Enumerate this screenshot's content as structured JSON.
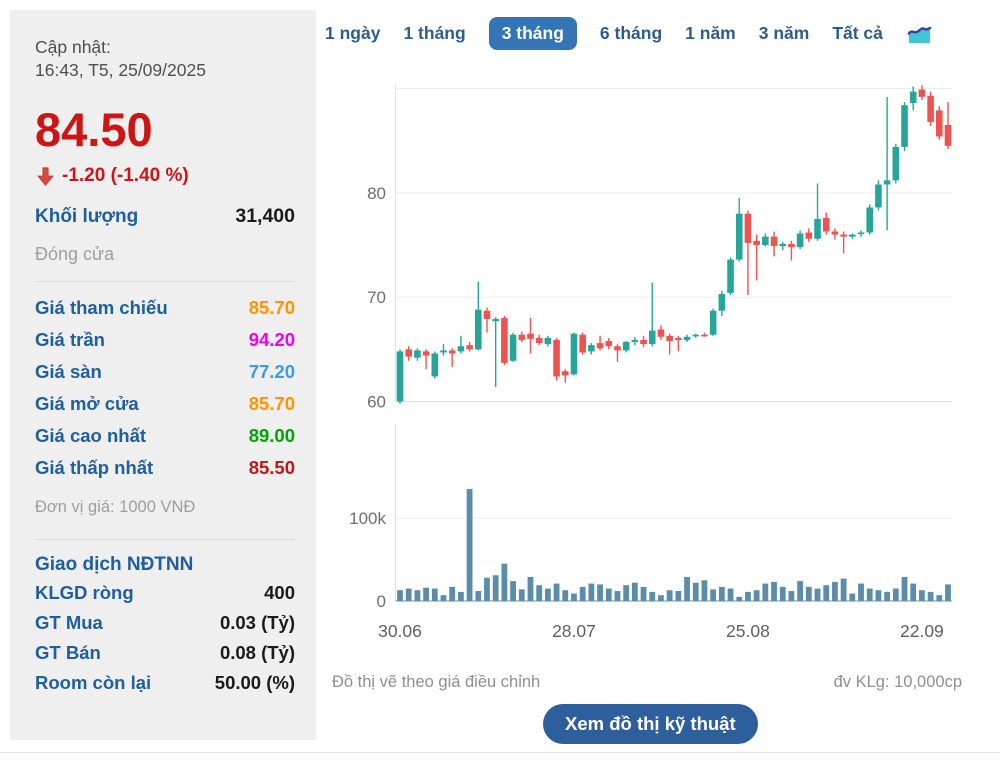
{
  "sidebar": {
    "updated_label": "Cập nhật:",
    "updated_time": "16:43, T5, 25/09/2025",
    "price": "84.50",
    "change": "-1.20 (-1.40 %)",
    "volume_label": "Khối lượng",
    "volume_value": "31,400",
    "session_status": "Đóng cửa",
    "price_rows": [
      {
        "label": "Giá tham chiếu",
        "value": "85.70",
        "color": "#ff9500"
      },
      {
        "label": "Giá trần",
        "value": "94.20",
        "color": "#f000f0"
      },
      {
        "label": "Giá sàn",
        "value": "77.20",
        "color": "#3e9be9"
      },
      {
        "label": "Giá mở cửa",
        "value": "85.70",
        "color": "#ff9500"
      },
      {
        "label": "Giá cao nhất",
        "value": "89.00",
        "color": "#00a400"
      },
      {
        "label": "Giá thấp nhất",
        "value": "85.50",
        "color": "#c01616"
      }
    ],
    "unit_note": "Đơn vị giá: 1000 VNĐ",
    "foreign_title": "Giao dịch NĐTNN",
    "foreign_rows": [
      {
        "label": "KLGD ròng",
        "value": "400"
      },
      {
        "label": "GT Mua",
        "value": "0.03 (Tỷ)"
      },
      {
        "label": "GT Bán",
        "value": "0.08 (Tỷ)"
      },
      {
        "label": "Room còn lại",
        "value": "50.00 (%)"
      }
    ]
  },
  "tabs": {
    "items": [
      {
        "label": "1 ngày",
        "active": false
      },
      {
        "label": "1 tháng",
        "active": false
      },
      {
        "label": "3 tháng",
        "active": true
      },
      {
        "label": "6 tháng",
        "active": false
      },
      {
        "label": "1 năm",
        "active": false
      },
      {
        "label": "3 năm",
        "active": false
      },
      {
        "label": "Tất cả",
        "active": false
      }
    ]
  },
  "footer": {
    "left_note": "Đồ thị vẽ theo giá điều chỉnh",
    "right_note": "đv KLg: 10,000cp",
    "button_label": "Xem đồ thị kỹ thuật"
  },
  "chart_data": {
    "type": "candlestick+volume",
    "title": "",
    "x_tick_indices": [
      0,
      20,
      40,
      60
    ],
    "x_tick_labels": [
      "30.06",
      "28.07",
      "25.08",
      "22.09"
    ],
    "price": {
      "ylim": [
        60,
        90
      ],
      "grid_values": [
        90,
        80,
        70
      ],
      "y_ticks": [
        {
          "value": 80,
          "label": "80"
        },
        {
          "value": 70,
          "label": "70"
        },
        {
          "value": 60,
          "label": "60"
        }
      ],
      "candles": [
        [
          60.0,
          65.0,
          59.8,
          64.8
        ],
        [
          65.0,
          65.3,
          63.9,
          64.3
        ],
        [
          64.2,
          65.1,
          63.9,
          64.9
        ],
        [
          64.8,
          65.0,
          63.1,
          64.4
        ],
        [
          62.4,
          64.8,
          62.2,
          64.6
        ],
        [
          64.7,
          65.5,
          64.4,
          64.9
        ],
        [
          64.9,
          65.1,
          63.3,
          64.6
        ],
        [
          64.8,
          66.3,
          64.6,
          65.3
        ],
        [
          65.4,
          65.7,
          64.8,
          65.0
        ],
        [
          65.0,
          71.5,
          64.9,
          68.8
        ],
        [
          68.7,
          69.0,
          66.6,
          67.9
        ],
        [
          67.7,
          68.1,
          61.4,
          67.9
        ],
        [
          68.0,
          68.2,
          63.5,
          63.7
        ],
        [
          63.9,
          66.6,
          63.8,
          66.4
        ],
        [
          66.4,
          66.7,
          65.7,
          65.9
        ],
        [
          66.5,
          68.0,
          64.6,
          66.0
        ],
        [
          66.1,
          66.4,
          65.4,
          65.6
        ],
        [
          65.5,
          66.3,
          65.3,
          66.1
        ],
        [
          65.9,
          66.1,
          62.0,
          62.4
        ],
        [
          62.9,
          63.1,
          61.8,
          62.5
        ],
        [
          62.6,
          66.6,
          62.5,
          66.5
        ],
        [
          66.4,
          66.6,
          64.5,
          64.7
        ],
        [
          64.8,
          65.6,
          64.5,
          65.4
        ],
        [
          65.6,
          66.3,
          64.9,
          65.1
        ],
        [
          65.8,
          66.1,
          65.0,
          65.3
        ],
        [
          65.3,
          65.5,
          63.8,
          64.9
        ],
        [
          64.9,
          65.8,
          64.7,
          65.7
        ],
        [
          65.7,
          66.2,
          65.4,
          65.9
        ],
        [
          65.9,
          66.3,
          65.2,
          65.5
        ],
        [
          65.5,
          71.4,
          65.3,
          66.8
        ],
        [
          66.9,
          67.3,
          65.9,
          66.2
        ],
        [
          66.3,
          66.5,
          64.5,
          65.8
        ],
        [
          66.1,
          66.3,
          64.8,
          65.9
        ],
        [
          65.9,
          66.4,
          65.7,
          66.2
        ],
        [
          66.3,
          66.5,
          66.1,
          66.4
        ],
        [
          66.4,
          66.6,
          66.2,
          66.3
        ],
        [
          66.4,
          68.9,
          66.3,
          68.7
        ],
        [
          68.7,
          70.6,
          68.2,
          70.3
        ],
        [
          70.4,
          73.8,
          70.2,
          73.6
        ],
        [
          73.6,
          79.5,
          73.4,
          78.0
        ],
        [
          78.0,
          78.3,
          70.2,
          75.2
        ],
        [
          75.4,
          76.0,
          71.6,
          75.0
        ],
        [
          75.0,
          76.1,
          74.9,
          75.8
        ],
        [
          75.8,
          76.3,
          73.9,
          74.9
        ],
        [
          74.9,
          75.3,
          74.5,
          75.1
        ],
        [
          75.1,
          75.4,
          73.5,
          74.8
        ],
        [
          74.8,
          76.4,
          74.6,
          76.1
        ],
        [
          76.2,
          76.6,
          75.3,
          75.6
        ],
        [
          75.6,
          80.9,
          75.4,
          77.5
        ],
        [
          77.6,
          78.1,
          76.0,
          76.3
        ],
        [
          76.3,
          76.6,
          75.5,
          76.0
        ],
        [
          76.0,
          76.3,
          74.2,
          75.8
        ],
        [
          75.8,
          76.1,
          75.6,
          76.0
        ],
        [
          76.1,
          76.4,
          75.8,
          76.2
        ],
        [
          76.2,
          78.9,
          76.0,
          78.6
        ],
        [
          78.6,
          81.2,
          78.3,
          80.8
        ],
        [
          80.8,
          89.2,
          76.4,
          81.2
        ],
        [
          81.2,
          84.7,
          80.9,
          84.4
        ],
        [
          84.4,
          88.7,
          84.0,
          88.4
        ],
        [
          88.6,
          90.2,
          87.9,
          89.7
        ],
        [
          89.9,
          90.3,
          88.9,
          89.2
        ],
        [
          89.3,
          89.7,
          86.4,
          86.8
        ],
        [
          87.9,
          88.3,
          85.1,
          85.4
        ],
        [
          86.5,
          88.7,
          84.2,
          84.5
        ]
      ]
    },
    "volume": {
      "unit": "k",
      "ymax_k": 160,
      "y_ticks": [
        {
          "value": 100,
          "label": "100k"
        },
        {
          "value": 0,
          "label": "0"
        }
      ],
      "values_k": [
        13,
        15,
        13,
        16,
        15,
        7,
        17,
        11,
        135,
        12,
        28,
        31,
        45,
        24,
        14,
        29,
        19,
        15,
        21,
        13,
        9,
        17,
        21,
        20,
        15,
        12,
        19,
        22,
        17,
        11,
        7,
        13,
        12,
        29,
        22,
        25,
        14,
        17,
        15,
        5,
        11,
        13,
        21,
        23,
        17,
        12,
        24,
        17,
        15,
        19,
        23,
        27,
        9,
        21,
        15,
        13,
        11,
        15,
        29,
        21,
        13,
        11,
        7,
        20
      ]
    },
    "colors": {
      "up": "#26a69a",
      "down": "#ef5350",
      "volume": "#5b8dab",
      "grid": "#ececec",
      "axis": "#e0e0e0",
      "vol_axis": "#b3c9d9",
      "tick_text": "#6e6e6e"
    }
  }
}
